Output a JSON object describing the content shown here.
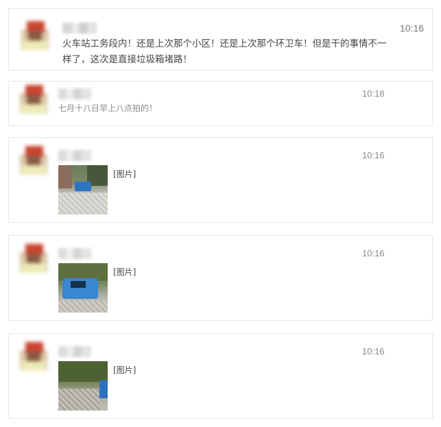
{
  "messages": [
    {
      "time": "10:16",
      "text_line1": "火车站工务段内！还是上次那个小区！还是上次那个环卫车！但是干的事情不一",
      "text_line2": "样了，这次是直接垃圾箱堵路！"
    },
    {
      "time": "10:18",
      "text": "七月十八日早上八点拍的！"
    },
    {
      "time": "10:16",
      "image_label": "[图片]"
    },
    {
      "time": "10:16",
      "image_label": "[图片]"
    },
    {
      "time": "10:16",
      "image_label": "[图片]"
    }
  ],
  "colors": {
    "card_border": "#e6e6e6",
    "time_text": "#8a8a8a",
    "message_text": "#555555",
    "avatar_red": "#c9442f"
  }
}
